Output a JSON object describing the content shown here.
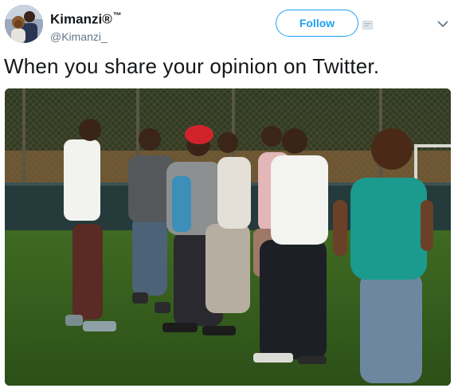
{
  "user": {
    "display_name": "Kimanzi",
    "registered_mark": "®",
    "trademark": "™",
    "handle": "@Kimanzi_"
  },
  "actions": {
    "follow_label": "Follow"
  },
  "tweet": {
    "text": "When you share your opinion on Twitter."
  },
  "icons": {
    "card": "card-icon",
    "caret": "chevron-down-icon"
  },
  "colors": {
    "accent": "#1da1f2",
    "text": "#14171a",
    "muted": "#657786"
  }
}
